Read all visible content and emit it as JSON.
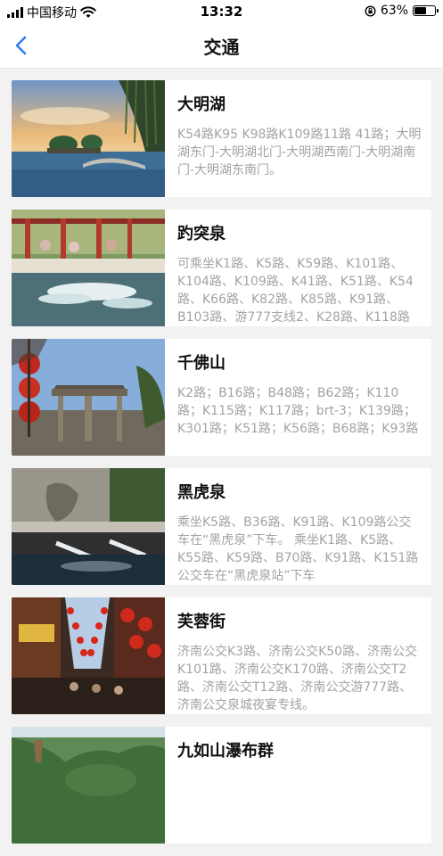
{
  "status_bar": {
    "carrier": "中国移动",
    "time": "13:32",
    "battery": "63%",
    "battery_level": 0.63,
    "icons": [
      "signal-icon",
      "wifi-icon",
      "rotation-lock-icon",
      "battery-icon"
    ]
  },
  "nav": {
    "title": "交通",
    "back_icon": "chevron-left-icon",
    "accent": "#2f7bf5"
  },
  "places": [
    {
      "name": "大明湖",
      "transport": "K54路K95 K98路K109路11路 41路；大明湖东门-大明湖北门-大明湖西南门-大明湖南门-大明湖东南门。"
    },
    {
      "name": "趵突泉",
      "transport": "可乘坐K1路、K5路、K59路、K101路、K104路、K109路、K41路、K51路、K54路、K66路、K82路、K85路、K91路、B103路、游777支线2、K28路、K118路"
    },
    {
      "name": "千佛山",
      "transport": "K2路；B16路；B48路；B62路；K110路；K115路；K117路；brt-3；K139路；K301路；K51路；K56路；B68路；K93路"
    },
    {
      "name": "黑虎泉",
      "transport": "乘坐K5路、B36路、K91路、K109路公交车在“黑虎泉”下车。\n乘坐K1路、K5路、K55路、K59路、B70路、K91路、K151路公交车在“黑虎泉站”下车"
    },
    {
      "name": "芙蓉街",
      "transport": "济南公交K3路、济南公交K50路、济南公交K101路、济南公交K170路、济南公交T2路、济南公交T12路、济南公交游777路、济南公交泉城夜宴专线。"
    },
    {
      "name": "九如山瀑布群",
      "transport": ""
    }
  ]
}
